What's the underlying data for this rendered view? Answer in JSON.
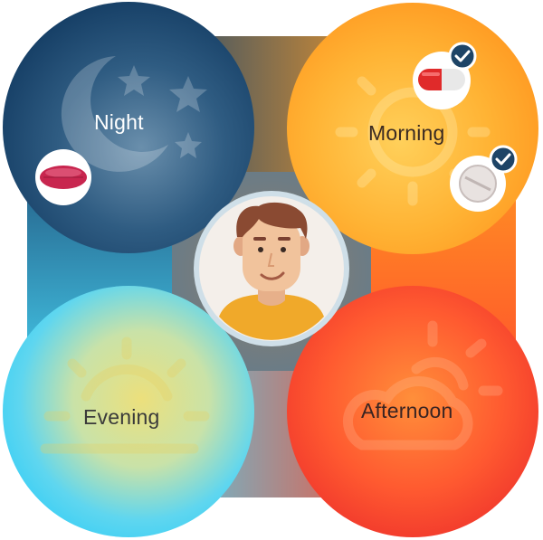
{
  "segments": {
    "night": {
      "label": "Night",
      "icon": "moon-stars-icon"
    },
    "morning": {
      "label": "Morning",
      "icon": "sun-icon"
    },
    "afternoon": {
      "label": "Afternoon",
      "icon": "cloud-sun-icon"
    },
    "evening": {
      "label": "Evening",
      "icon": "sunset-icon"
    }
  },
  "pills": [
    {
      "slot": "night",
      "type": "oval-tablet",
      "color": "#c8264f",
      "taken": false
    },
    {
      "slot": "morning",
      "type": "capsule",
      "color": "#e02a2a",
      "taken": true
    },
    {
      "slot": "morning",
      "type": "round-tablet",
      "color": "#e8e2e0",
      "taken": true
    }
  ],
  "avatar": {
    "icon": "user-avatar"
  },
  "colors": {
    "night": "#1f4f7a",
    "morning": "#ffa424",
    "afternoon": "#ff4a2e",
    "evening": "#44d8f6",
    "check": "#1e4466"
  }
}
